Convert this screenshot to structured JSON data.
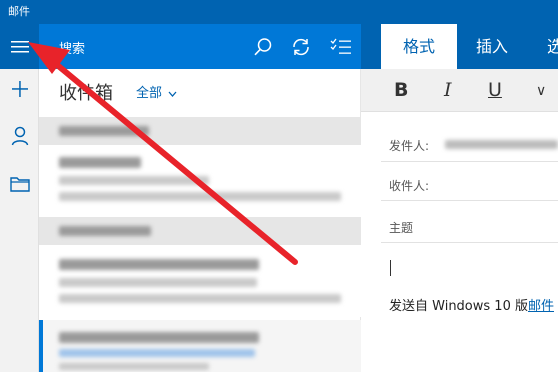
{
  "app": {
    "title": "邮件"
  },
  "search": {
    "label": "搜索"
  },
  "inbox": {
    "title": "收件箱",
    "filter": "全部"
  },
  "ribbon": {
    "tabs": [
      {
        "label": "格式"
      },
      {
        "label": "插入"
      },
      {
        "label": "选"
      }
    ]
  },
  "toolbar": {
    "bold": "B",
    "italic": "I",
    "underline": "U",
    "more": "∨"
  },
  "compose": {
    "from_label": "发件人:",
    "to_label": "收件人:",
    "subject_label": "主题",
    "signature_prefix": "发送自 Windows 10 版",
    "signature_link": "邮件"
  },
  "icons": {
    "menu": "hamburger-icon",
    "new_mail": "plus-icon",
    "accounts": "person-icon",
    "folders": "folder-icon",
    "search": "search-icon",
    "sync": "sync-icon",
    "select": "select-icon",
    "filter_dropdown": "chevron-down-icon"
  },
  "colors": {
    "title_bar": "#0063b1",
    "search_bar": "#0078d7",
    "accent": "#0063b1",
    "annotation_arrow": "#e8232a"
  }
}
